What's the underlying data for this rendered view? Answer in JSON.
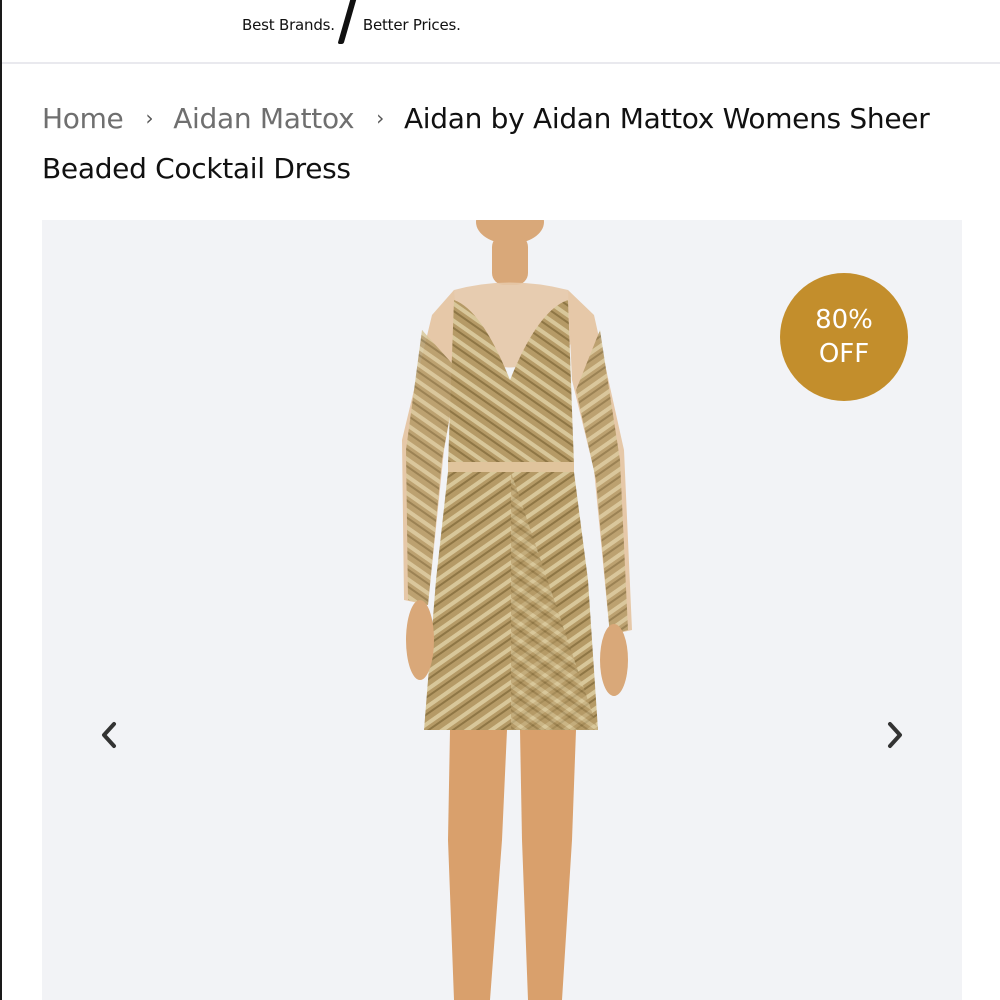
{
  "header": {
    "tagline_left": "Best Brands.",
    "tagline_right": "Better Prices."
  },
  "breadcrumb": {
    "items": [
      {
        "label": "Home"
      },
      {
        "label": "Aidan Mattox"
      }
    ],
    "separator": "›",
    "current": "Aidan by Aidan Mattox Womens Sheer Beaded Cocktail Dress"
  },
  "gallery": {
    "badge_line1": "80%",
    "badge_line2": "OFF",
    "badge_color": "#c38e2c",
    "prev_icon": "chevron-left-icon",
    "next_icon": "chevron-right-icon",
    "background": "#f2f3f6"
  }
}
